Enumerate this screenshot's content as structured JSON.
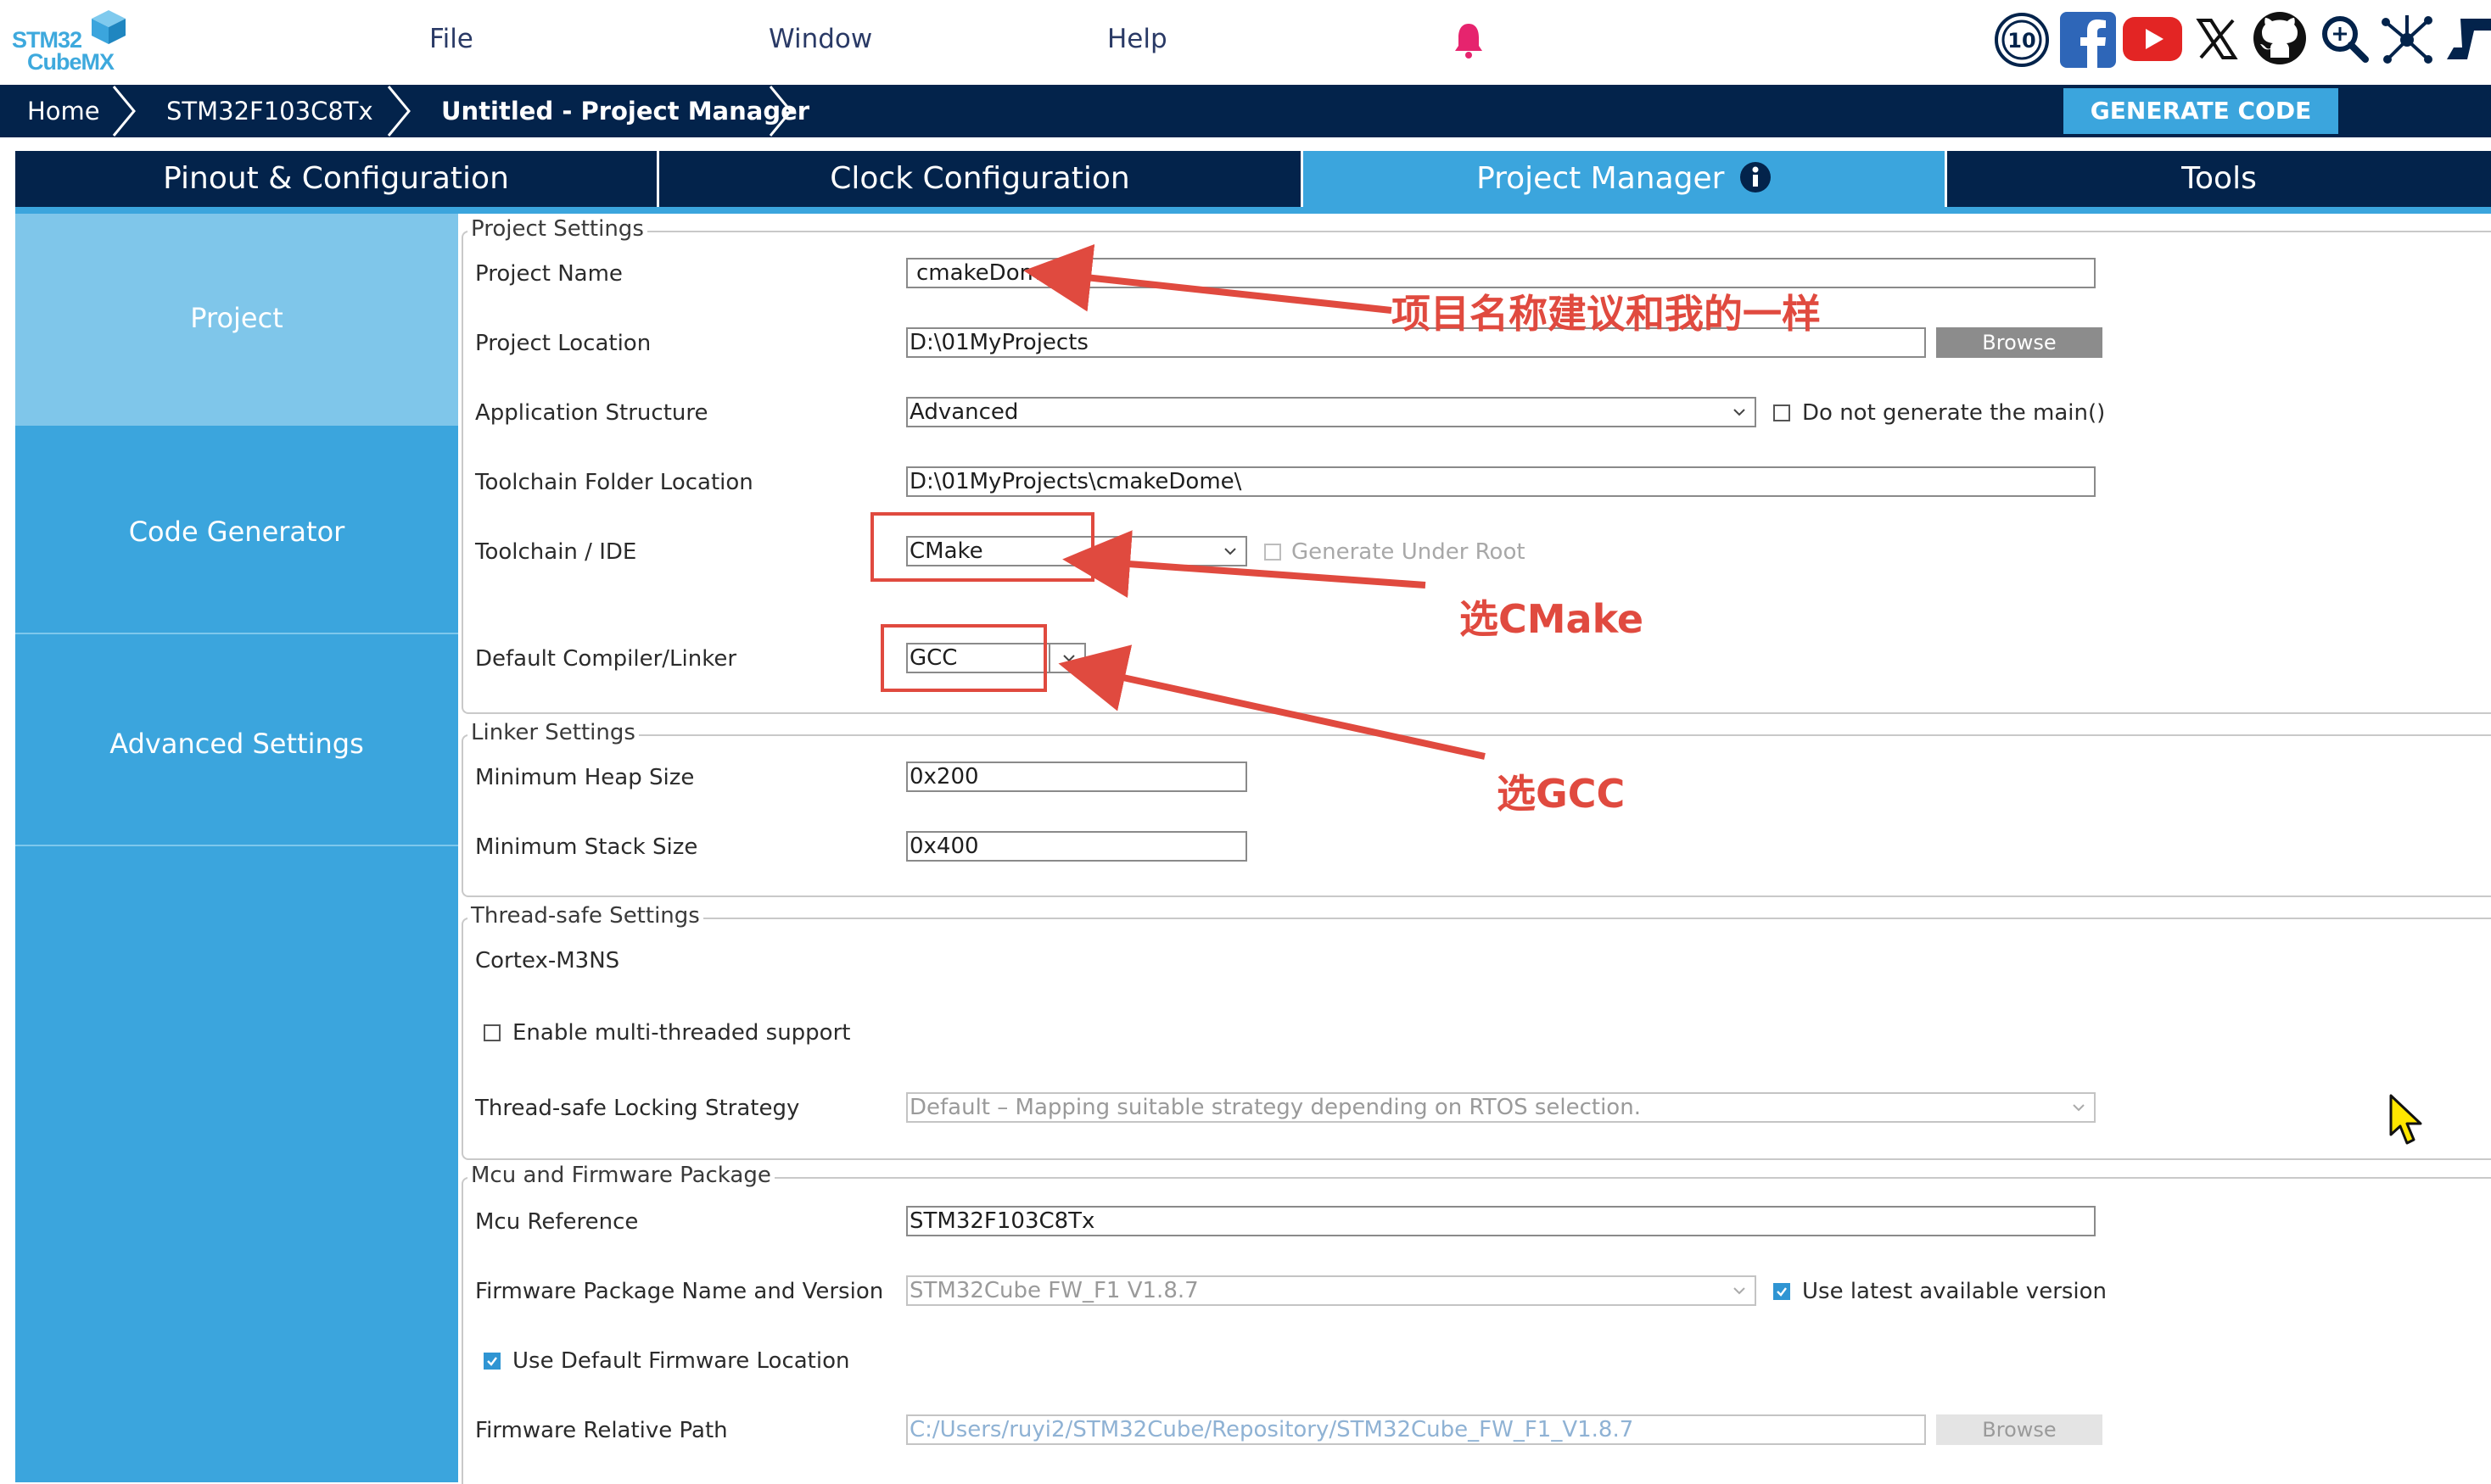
{
  "app": {
    "logo_line1": "STM32",
    "logo_line2": "CubeMX",
    "brand_color": "#3ba5dd",
    "dark_color": "#03234b"
  },
  "menu": {
    "file": "File",
    "window": "Window",
    "help": "Help"
  },
  "social_icons": [
    "anniversary-10-icon",
    "facebook-icon",
    "youtube-icon",
    "x-icon",
    "github-icon",
    "search-zoom-icon",
    "network-icon",
    "st-logo-icon"
  ],
  "breadcrumb": {
    "home": "Home",
    "mcu": "STM32F103C8Tx",
    "project": "Untitled - Project Manager"
  },
  "generate_button": "GENERATE CODE",
  "tabs": [
    {
      "label": "Pinout & Configuration"
    },
    {
      "label": "Clock Configuration"
    },
    {
      "label": "Project Manager"
    },
    {
      "label": "Tools"
    }
  ],
  "sidebar": {
    "items": [
      {
        "label": "Project"
      },
      {
        "label": "Code Generator"
      },
      {
        "label": "Advanced Settings"
      }
    ]
  },
  "project_settings": {
    "title": "Project Settings",
    "project_name_label": "Project Name",
    "project_name_value": "cmakeDome",
    "project_location_label": "Project Location",
    "project_location_value": "D:\\01MyProjects",
    "browse_label": "Browse",
    "app_structure_label": "Application Structure",
    "app_structure_value": "Advanced",
    "do_not_generate_main_label": "Do not generate the main()",
    "toolchain_folder_label": "Toolchain Folder Location",
    "toolchain_folder_value": "D:\\01MyProjects\\cmakeDome\\",
    "toolchain_ide_label": "Toolchain / IDE",
    "toolchain_ide_value": "CMake",
    "generate_under_root_label": "Generate Under Root",
    "compiler_label": "Default Compiler/Linker",
    "compiler_value": "GCC"
  },
  "linker_settings": {
    "title": "Linker Settings",
    "heap_label": "Minimum Heap Size",
    "heap_value": "0x200",
    "stack_label": "Minimum Stack Size",
    "stack_value": "0x400"
  },
  "thread_settings": {
    "title": "Thread-safe Settings",
    "core_label": "Cortex-M3NS",
    "multithread_label": "Enable multi-threaded support",
    "locking_label": "Thread-safe Locking Strategy",
    "locking_value": "Default – Mapping suitable strategy depending on RTOS selection."
  },
  "mcu_firmware": {
    "title": "Mcu and Firmware Package",
    "mcu_ref_label": "Mcu Reference",
    "mcu_ref_value": "STM32F103C8Tx",
    "fw_name_label": "Firmware Package Name and Version",
    "fw_name_value": "STM32Cube FW_F1 V1.8.7",
    "use_latest_label": "Use latest available version",
    "use_default_location_label": "Use Default Firmware Location",
    "fw_path_label": "Firmware Relative Path",
    "fw_path_value": "C:/Users/ruyi2/STM32Cube/Repository/STM32Cube_FW_F1_V1.8.7",
    "browse_label": "Browse"
  },
  "annotations": {
    "name_note": "项目名称建议和我的一样",
    "cmake_note": "选CMake",
    "gcc_note": "选GCC",
    "color": "#e04a3f"
  }
}
